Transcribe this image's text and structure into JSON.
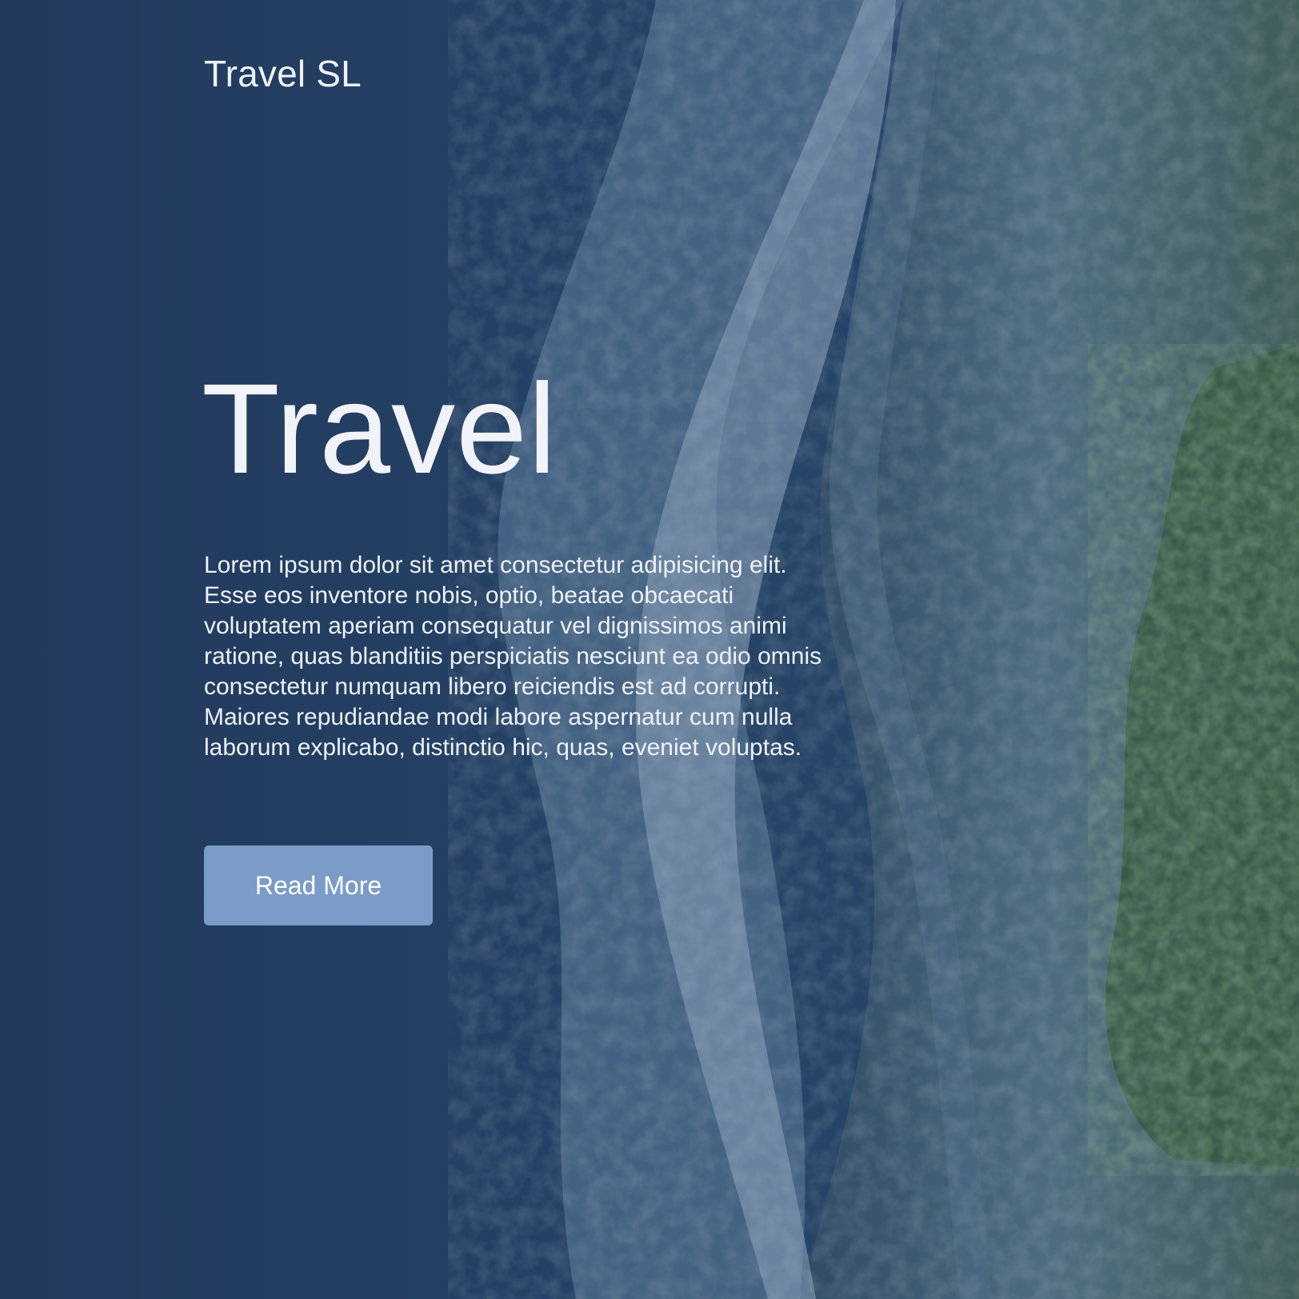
{
  "header": {
    "brand": "Travel SL"
  },
  "hero": {
    "title": "Travel",
    "description": "Lorem ipsum dolor sit amet consectetur adipisicing elit. Esse eos inventore nobis, optio, beatae obcaecati voluptatem aperiam consequatur vel dignissimos animi ratione, quas blanditiis perspiciatis nesciunt ea odio omnis consectetur numquam libero reiciendis est ad corrupti. Maiores repudiandae modi labore aspernatur cum nulla laborum explicabo, distinctio hic, quas, eveniet voluptas.",
    "button_label": "Read More",
    "background_image": "aerial-coastline-photo"
  },
  "colors": {
    "overlay": "#1f3554",
    "button": "#7b9bc9",
    "text": "#eef1f6"
  }
}
